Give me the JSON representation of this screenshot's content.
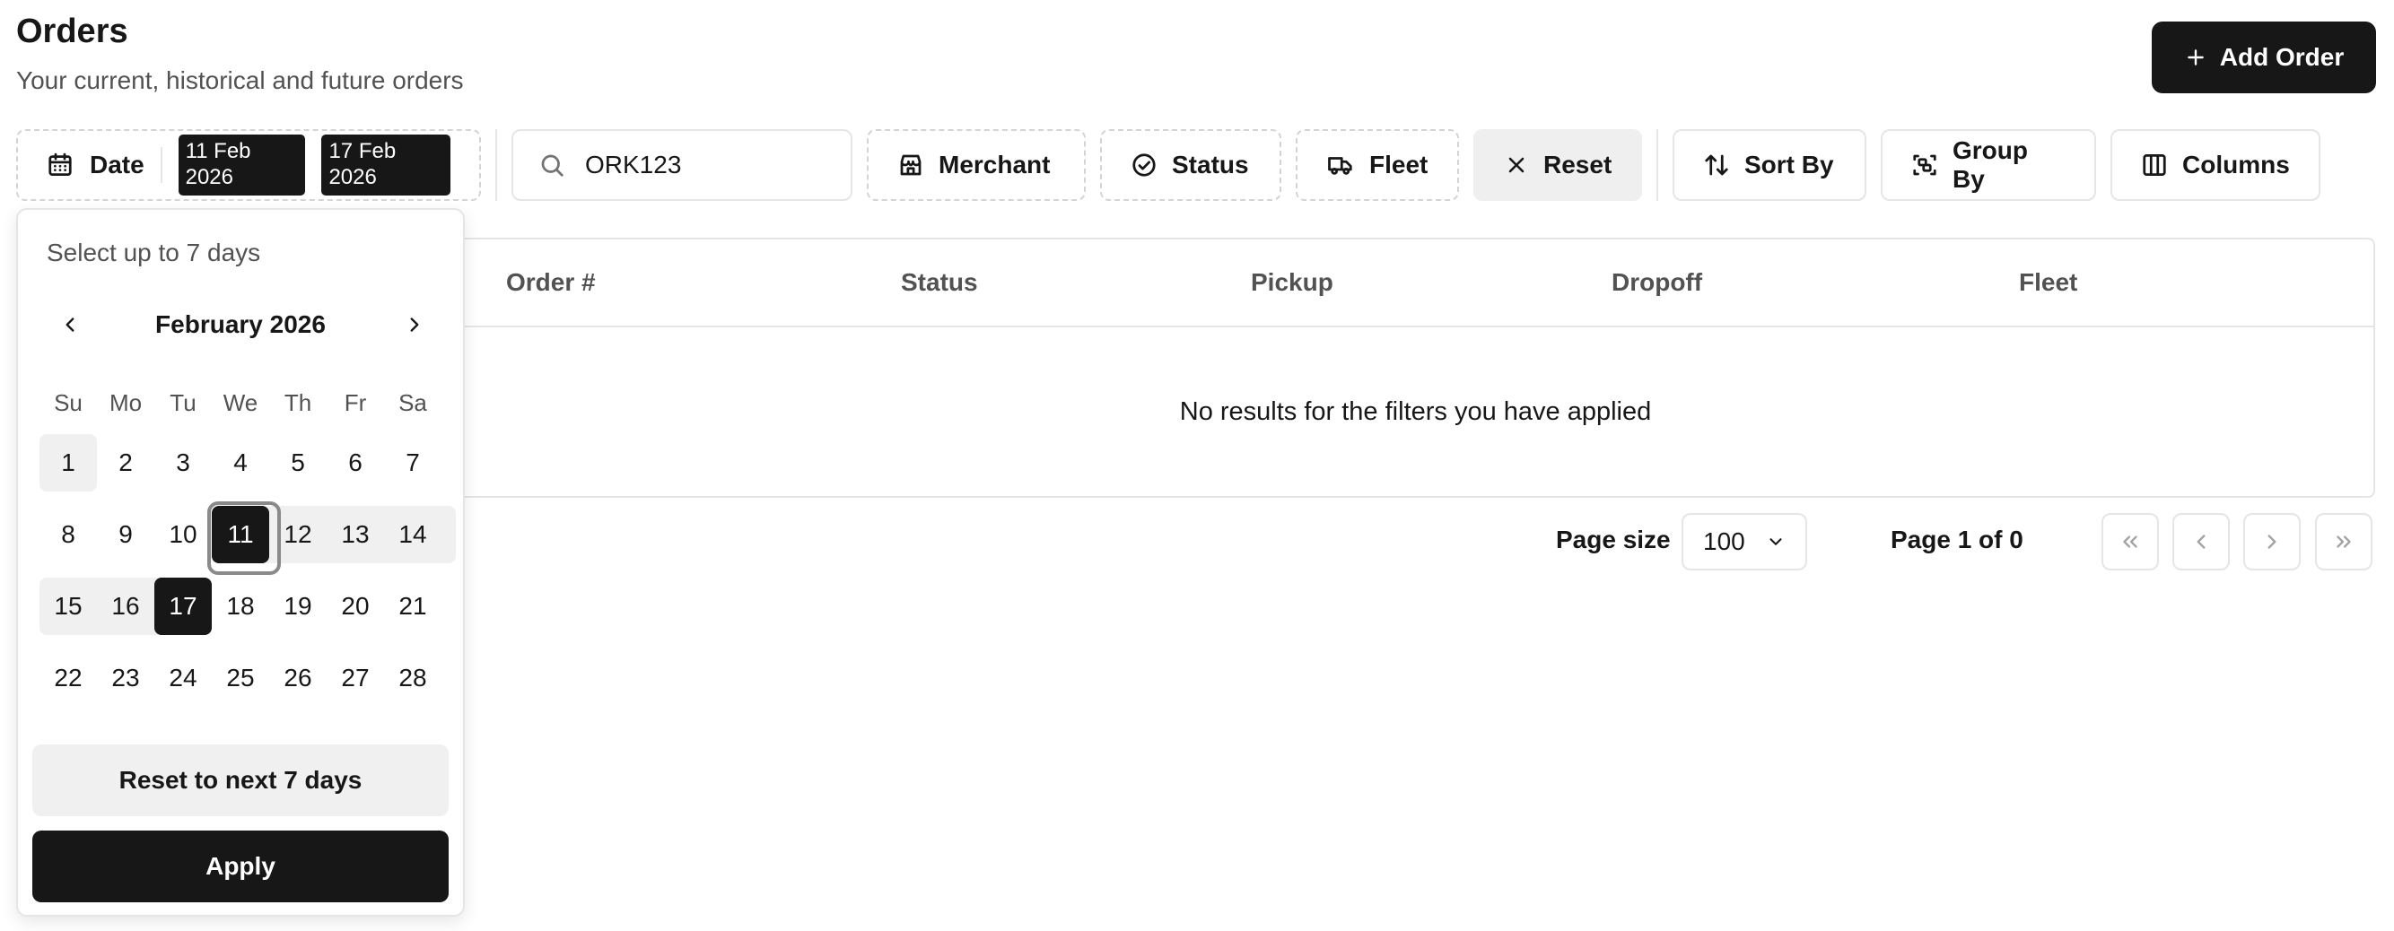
{
  "header": {
    "title": "Orders",
    "subtitle": "Your current, historical and future orders",
    "add_order_label": "Add Order"
  },
  "toolbar": {
    "date_label": "Date",
    "date_start": "11 Feb 2026",
    "date_end": "17 Feb 2026",
    "search_value": "ORK123",
    "merchant_label": "Merchant",
    "status_label": "Status",
    "fleet_label": "Fleet",
    "reset_label": "Reset",
    "sort_label": "Sort By",
    "group_label": "Group By",
    "columns_label": "Columns"
  },
  "table": {
    "columns": [
      "Order #",
      "Status",
      "Pickup",
      "Dropoff",
      "Fleet"
    ],
    "empty_message": "No results for the filters you have applied"
  },
  "pagination": {
    "page_size_label": "Page size",
    "page_size_value": "100",
    "page_info": "Page 1 of 0"
  },
  "calendar": {
    "hint": "Select up to 7 days",
    "month_label": "February 2026",
    "weekdays": [
      "Su",
      "Mo",
      "Tu",
      "We",
      "Th",
      "Fr",
      "Sa"
    ],
    "weeks": [
      [
        "1",
        "2",
        "3",
        "4",
        "5",
        "6",
        "7"
      ],
      [
        "8",
        "9",
        "10",
        "11",
        "12",
        "13",
        "14"
      ],
      [
        "15",
        "16",
        "17",
        "18",
        "19",
        "20",
        "21"
      ],
      [
        "22",
        "23",
        "24",
        "25",
        "26",
        "27",
        "28"
      ]
    ],
    "selected_start": "11",
    "selected_end": "17",
    "today": "1",
    "reset_label": "Reset to next 7 days",
    "apply_label": "Apply"
  },
  "icons": {
    "add": "plus-icon",
    "date": "calendar-icon",
    "search": "search-icon",
    "merchant": "store-icon",
    "status": "check-circle-icon",
    "fleet": "truck-icon",
    "reset": "x-icon",
    "sort": "arrows-up-down-icon",
    "group": "group-icon",
    "columns": "columns-icon"
  },
  "colors": {
    "primary": "#171717",
    "muted_text": "#525252",
    "border": "#e5e5e5",
    "range_fill": "#f0f0f0"
  }
}
